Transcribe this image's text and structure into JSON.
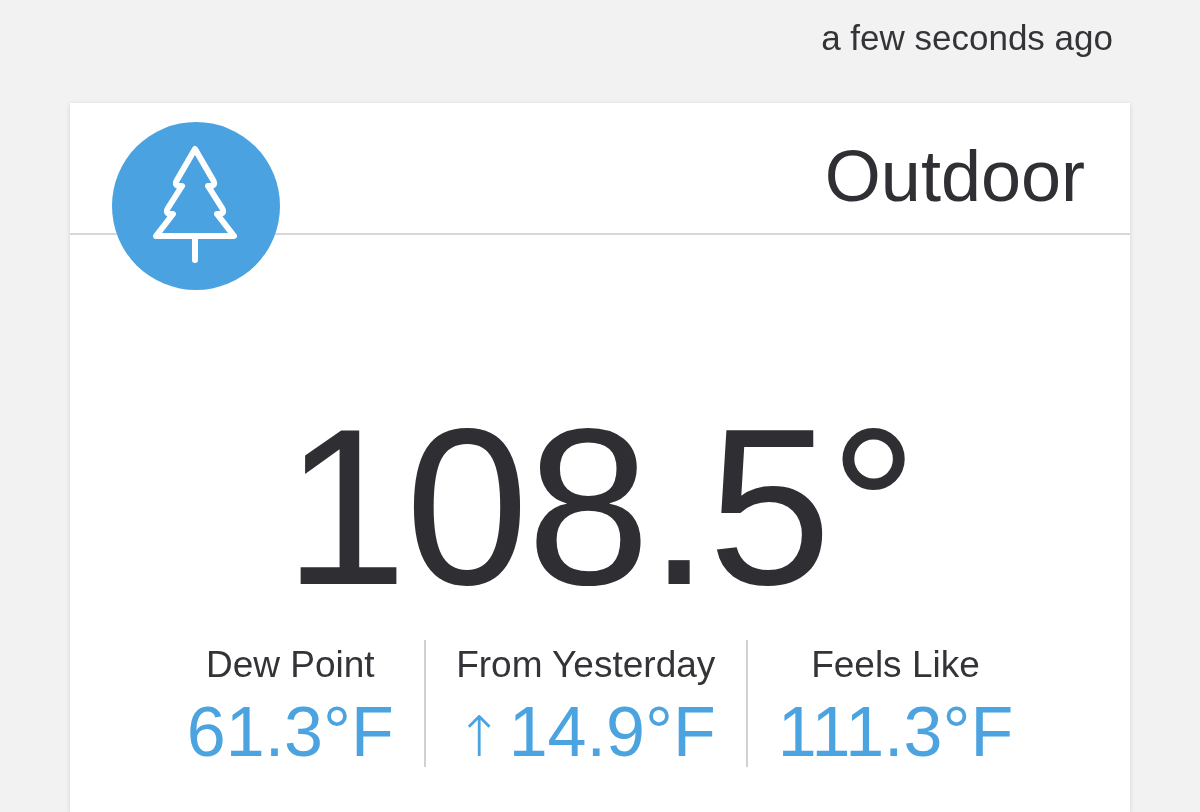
{
  "updated": "a few seconds ago",
  "card": {
    "title": "Outdoor",
    "temperature": "108.5°",
    "stats": [
      {
        "label": "Dew Point",
        "value": "61.3°F"
      },
      {
        "label": "From Yesterday",
        "trend": "↑",
        "value": "14.9°F"
      },
      {
        "label": "Feels Like",
        "value": "111.3°F"
      }
    ]
  }
}
